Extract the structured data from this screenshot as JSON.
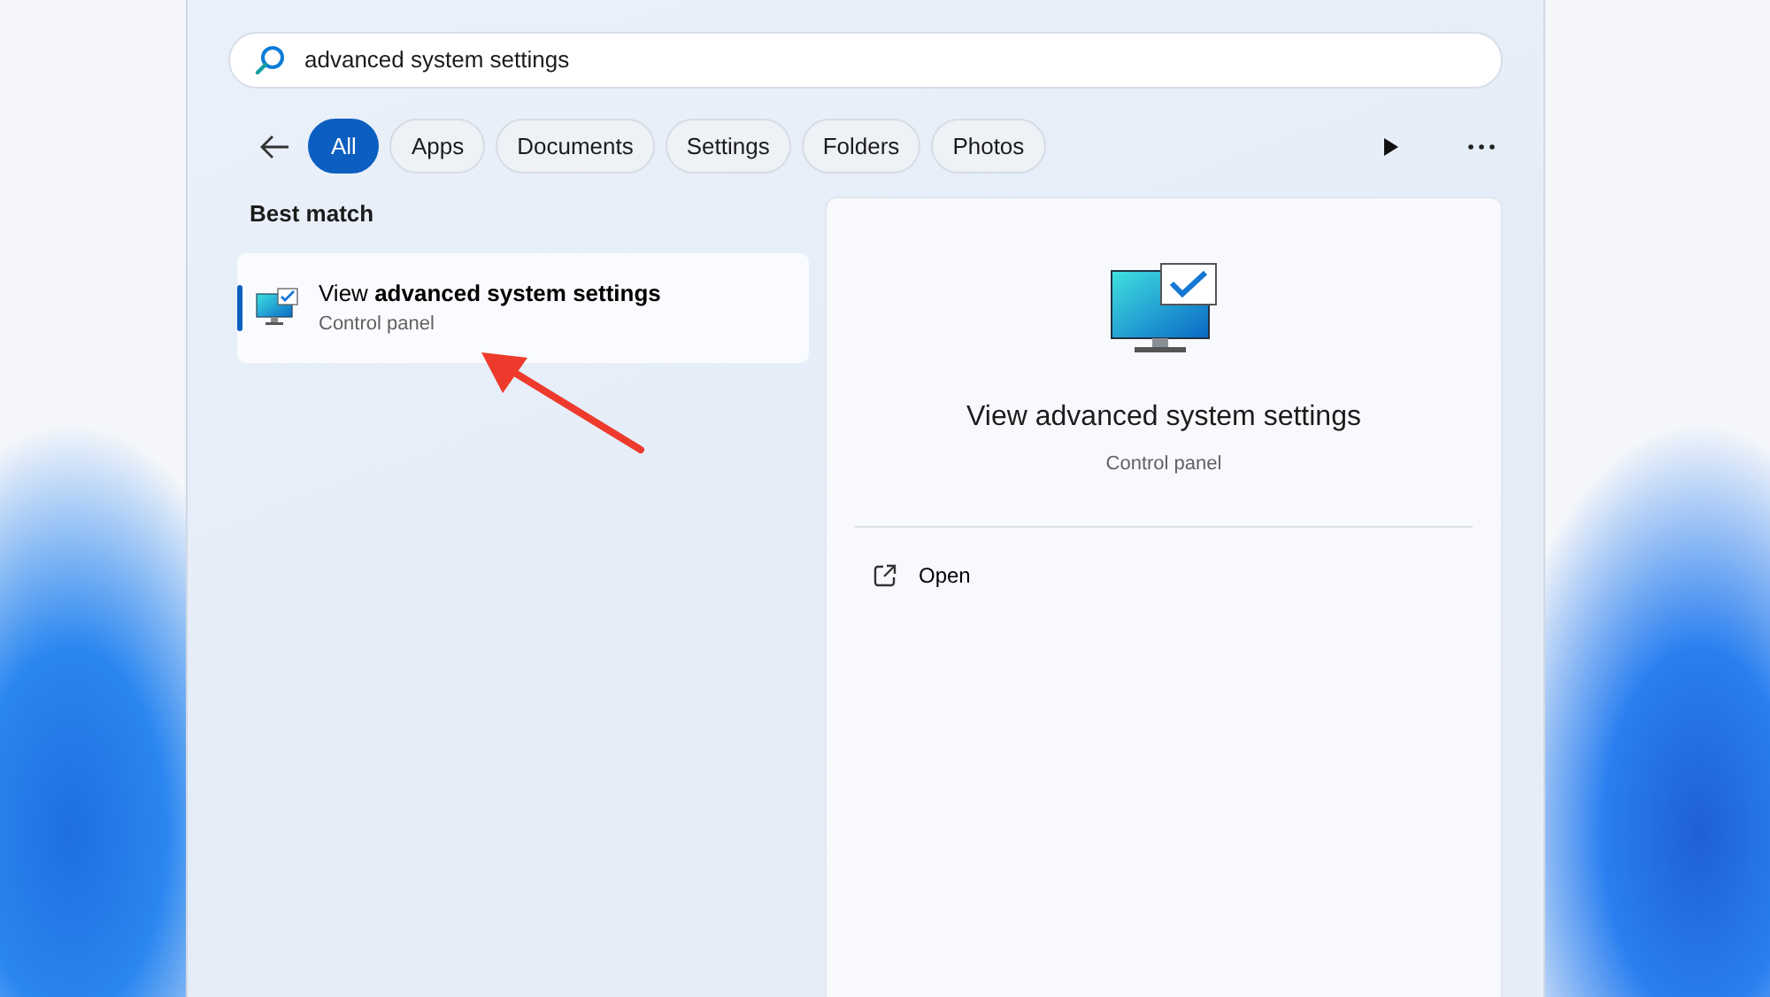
{
  "search": {
    "value": "advanced system settings"
  },
  "filters": [
    {
      "label": "All",
      "selected": true
    },
    {
      "label": "Apps",
      "selected": false
    },
    {
      "label": "Documents",
      "selected": false
    },
    {
      "label": "Settings",
      "selected": false
    },
    {
      "label": "Folders",
      "selected": false
    },
    {
      "label": "Photos",
      "selected": false
    }
  ],
  "section_title": "Best match",
  "best_match": {
    "title": "View **advanced system settings**",
    "subtitle": "Control panel",
    "selected": true
  },
  "detail": {
    "title": "View advanced system settings",
    "subtitle": "Control panel",
    "actions": [
      {
        "label": "Open"
      }
    ]
  }
}
